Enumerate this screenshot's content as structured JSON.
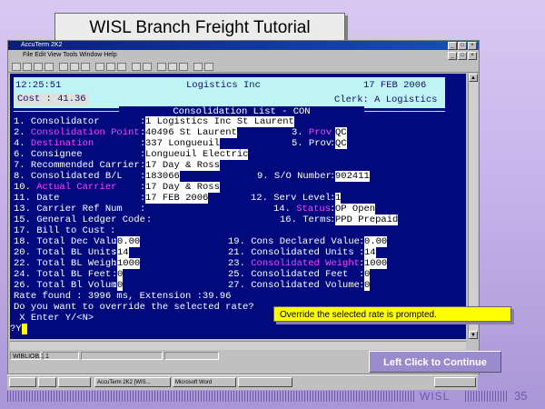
{
  "slide": {
    "title": "WISL Branch Freight Tutorial",
    "continue_label": "Left Click to Continue",
    "footer_brand": "WISL",
    "page_number": "35"
  },
  "app": {
    "window_title": "AccuTerm 2K2",
    "menu_text": "File Edit View Tools Window Help"
  },
  "header": {
    "time": "12:25:51",
    "company": "Logistics Inc",
    "date": "17 FEB 2006",
    "cost": "Cost : 41.36",
    "clerk": "Clerk: A Logistics",
    "screen_title": "Consolidation List - CON"
  },
  "fields": {
    "f1": {
      "label": "1. Consolidator",
      "value": "1 Logistics Inc St Laurent"
    },
    "f2": {
      "label": "2. Consolidation Point",
      "value": "40496 St Laurent"
    },
    "f3": {
      "label": "3. Prov",
      "value": "QC"
    },
    "f4": {
      "label": "4. Destination",
      "value": "337 Longueuil"
    },
    "f5": {
      "label": "5. Prov",
      "value": "QC"
    },
    "f6": {
      "label": "6. Consignee",
      "value": "Longueuil Electric"
    },
    "f7": {
      "label": "7. Recommended Carrier",
      "value": "17 Day & Ross"
    },
    "f8": {
      "label": "8. Consolidated B/L",
      "value": "183066"
    },
    "f9": {
      "label": "9. S/O Number",
      "value": "902411"
    },
    "f10": {
      "label": "10. Actual Carrier",
      "value": "17 Day & Ross"
    },
    "f11": {
      "label": "11. Date",
      "value": "17 FEB 2006"
    },
    "f12": {
      "label": "12. Serv Level",
      "value": "1"
    },
    "f13": {
      "label": "13. Carrier Ref Num",
      "value": ""
    },
    "f14": {
      "label": "14. Status",
      "value": "OP Open"
    },
    "f15": {
      "label": "15. General Ledger Code",
      "value": ""
    },
    "f16": {
      "label": "16. Terms",
      "value": "PPD Prepaid"
    },
    "f17": {
      "label": "17. Bill to Cust",
      "value": ""
    },
    "f18": {
      "label": "18. Total Dec Value",
      "value": "0.00"
    },
    "f19": {
      "label": "19. Cons Declared Value",
      "value": "0.00"
    },
    "f20": {
      "label": "20. Total BL Units",
      "value": "14"
    },
    "f21": {
      "label": "21. Consolidated Units",
      "value": "14"
    },
    "f22": {
      "label": "22. Total BL Weight",
      "value": "1000"
    },
    "f23": {
      "label": "23. Consolidated Weight",
      "value": "1000"
    },
    "f24": {
      "label": "24. Total BL Feet",
      "value": "0"
    },
    "f25": {
      "label": "25. Consolidated Feet",
      "value": "0"
    },
    "f26": {
      "label": "26. Total Bl Volume",
      "value": "0"
    },
    "f27": {
      "label": "27. Consolidated Volume",
      "value": "0"
    }
  },
  "messages": {
    "rate": "Rate found : 3996 ms, Extension :39.96",
    "prompt": "Do you want to override the selected rate?",
    "options": " X Enter Y/<N>",
    "input": "?Y"
  },
  "callout": {
    "text": "Override the selected rate is prompted."
  },
  "statusbar": {
    "c1": "WIBLIOB.1",
    "c2": "1",
    "c3": "",
    "c4": ""
  },
  "taskbar": {
    "b1": "AccuTerm 2K2 [WIS...",
    "b2": "Microsoft Word",
    "b3": "",
    "b4": ""
  }
}
